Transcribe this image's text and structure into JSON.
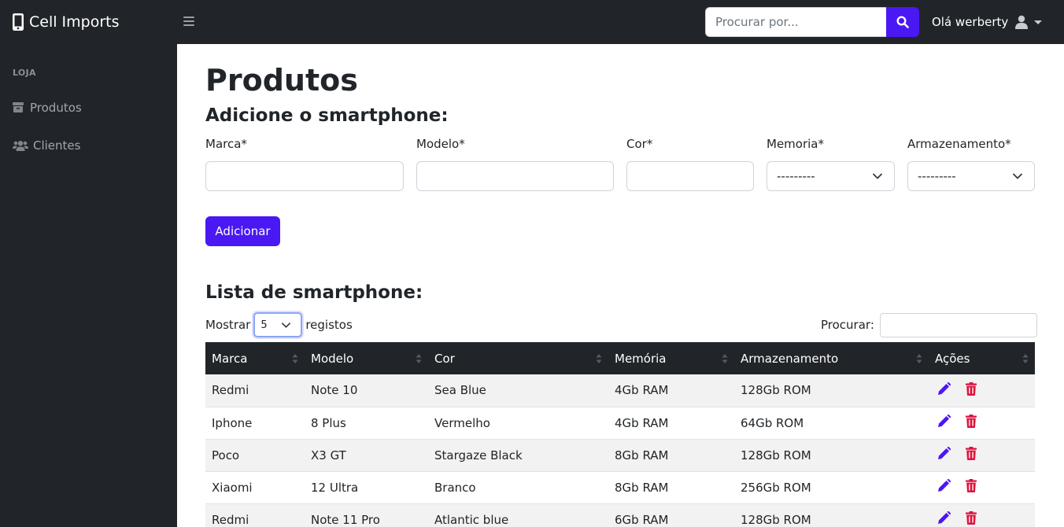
{
  "brand": {
    "title": "Cell Imports",
    "icon": "mobile-icon"
  },
  "navbar": {
    "search_placeholder": "Procurar por...",
    "search_button_icon": "search-icon",
    "user_greeting": "Olá werberty",
    "user_icon": "user-icon",
    "accent_color": "#4a18f2"
  },
  "sidebar": {
    "heading": "LOJA",
    "items": [
      {
        "label": "Produtos",
        "icon": "box-icon"
      },
      {
        "label": "Clientes",
        "icon": "users-icon"
      }
    ]
  },
  "main": {
    "title": "Produtos",
    "form": {
      "heading": "Adicione o smartphone:",
      "fields": {
        "marca": {
          "label": "Marca*",
          "value": ""
        },
        "modelo": {
          "label": "Modelo*",
          "value": ""
        },
        "cor": {
          "label": "Cor*",
          "value": ""
        },
        "memoria": {
          "label": "Memoria*",
          "value": "---------"
        },
        "armazenamento": {
          "label": "Armazenamento*",
          "value": "---------"
        }
      },
      "submit_label": "Adicionar"
    },
    "list": {
      "heading": "Lista de smartphone:",
      "show_prefix": "Mostrar",
      "show_value": "5",
      "show_suffix": "registos",
      "filter_label": "Procurar:",
      "filter_value": "",
      "columns": [
        "Marca",
        "Modelo",
        "Cor",
        "Memória",
        "Armazenamento",
        "Ações"
      ],
      "rows": [
        {
          "marca": "Redmi",
          "modelo": "Note 10",
          "cor": "Sea Blue",
          "memoria": "4Gb RAM",
          "armazenamento": "128Gb ROM"
        },
        {
          "marca": "Iphone",
          "modelo": "8 Plus",
          "cor": "Vermelho",
          "memoria": "4Gb RAM",
          "armazenamento": "64Gb ROM"
        },
        {
          "marca": "Poco",
          "modelo": "X3 GT",
          "cor": "Stargaze Black",
          "memoria": "8Gb RAM",
          "armazenamento": "128Gb ROM"
        },
        {
          "marca": "Xiaomi",
          "modelo": "12 Ultra",
          "cor": "Branco",
          "memoria": "8Gb RAM",
          "armazenamento": "256Gb ROM"
        },
        {
          "marca": "Redmi",
          "modelo": "Note 11 Pro",
          "cor": "Atlantic blue",
          "memoria": "6Gb RAM",
          "armazenamento": "128Gb ROM"
        }
      ],
      "action_icons": {
        "edit": "pencil-icon",
        "delete": "trash-icon"
      },
      "edit_color": "#4a18f2",
      "delete_color": "#dc143c"
    }
  }
}
